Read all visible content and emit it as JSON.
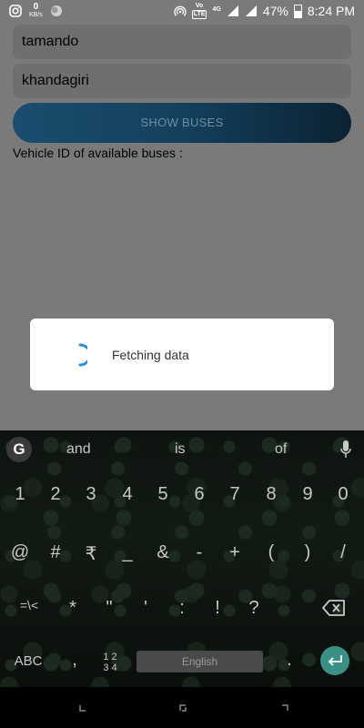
{
  "status_bar": {
    "net_speed_value": "0",
    "net_speed_unit": "KB/s",
    "volte_top": "Vo",
    "volte_bottom": "LTE",
    "network_type": "4G",
    "battery_percent": "47%",
    "time": "8:24 PM",
    "icons": [
      "instagram-icon",
      "circle-app-icon",
      "hotspot-icon",
      "volte-icon",
      "signal-4g-icon",
      "signal-icon",
      "battery-icon"
    ]
  },
  "form": {
    "source_value": "tamando",
    "destination_value": "khandagiri",
    "show_buses_label": "SHOW BUSES",
    "vehicle_label": "Vehicle ID of available buses :"
  },
  "dialog": {
    "message": "Fetching data",
    "spinner_color": "#2a8fd8"
  },
  "keyboard": {
    "suggestions": [
      "and",
      "is",
      "of"
    ],
    "row_numbers": [
      "1",
      "2",
      "3",
      "4",
      "5",
      "6",
      "7",
      "8",
      "9",
      "0"
    ],
    "row_symbols1": [
      "@",
      "#",
      "₹",
      "_",
      "&",
      "-",
      "+",
      "(",
      ")",
      "/"
    ],
    "row_symbols2": [
      "=\\<",
      "*",
      "\"",
      "'",
      ":",
      "!",
      "?"
    ],
    "abc_label": "ABC",
    "comma": ",",
    "num_switch_top": "1 2",
    "num_switch_bottom": "3 4",
    "space_label": "English",
    "period": ".",
    "enter_color": "#3c8f87"
  }
}
